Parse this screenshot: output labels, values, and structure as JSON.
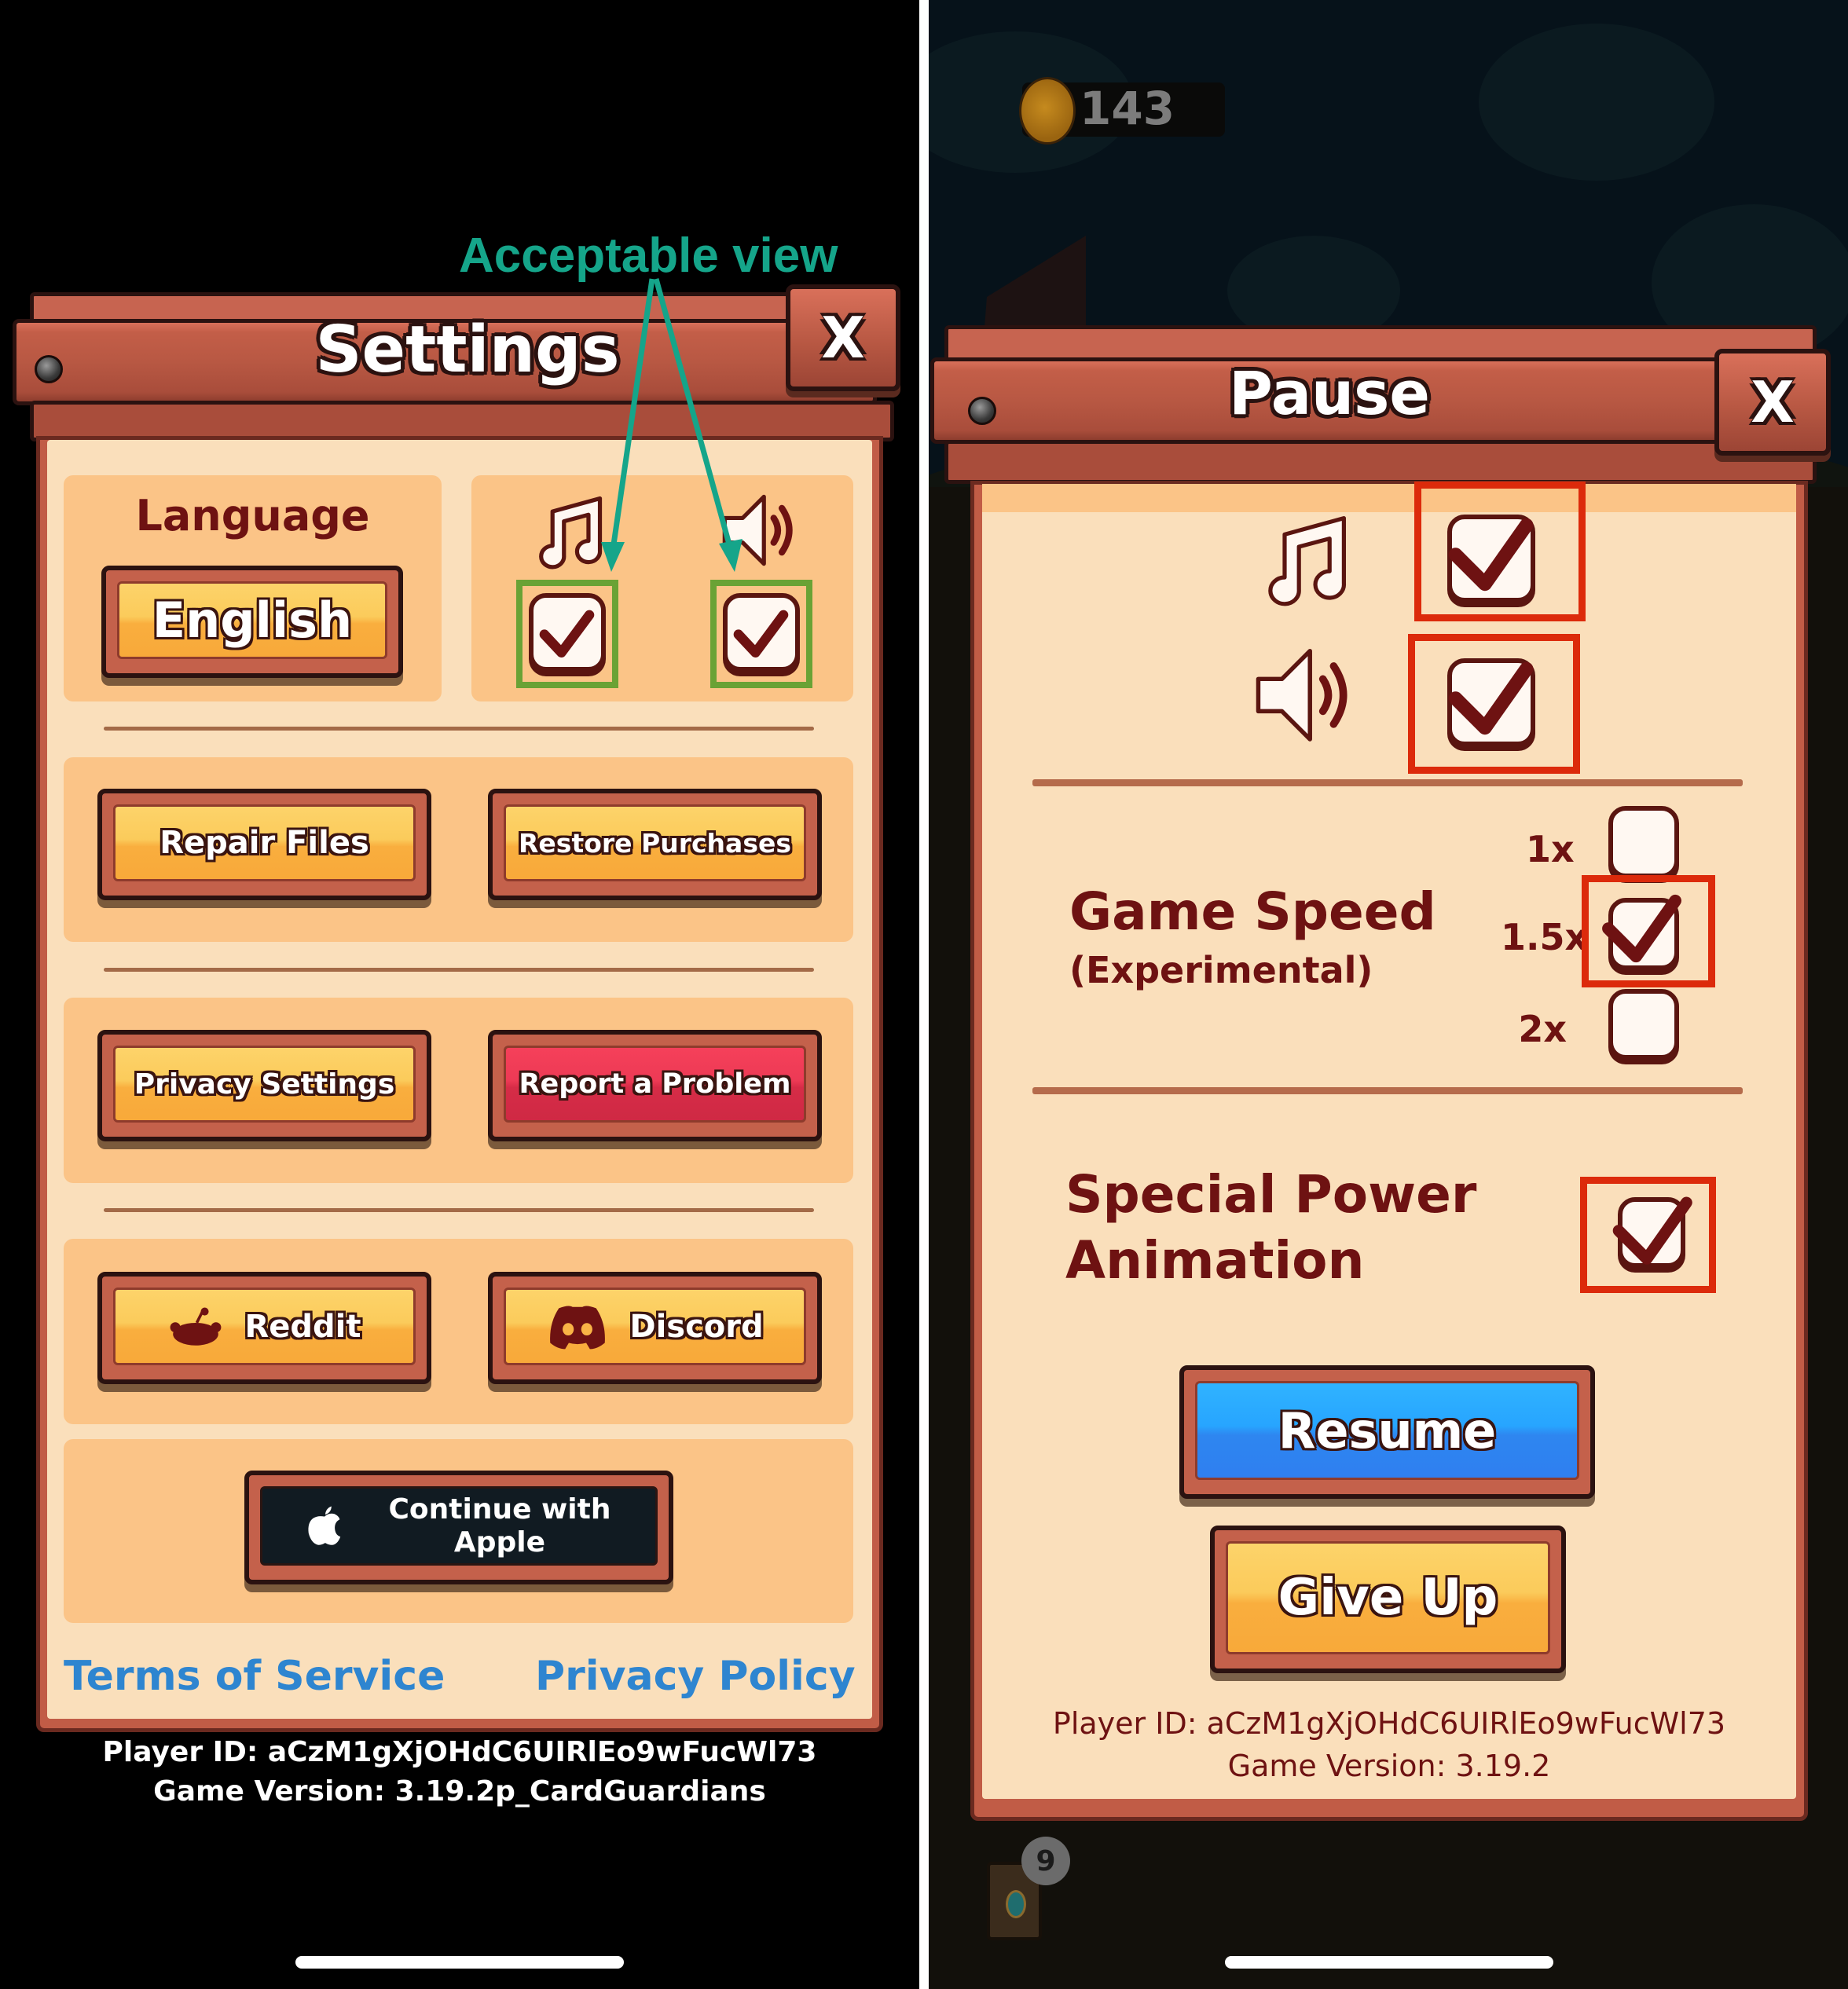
{
  "annotation": {
    "label": "Acceptable view",
    "color": "#15a58a"
  },
  "settings_screen": {
    "title": "Settings",
    "close_label": "X",
    "language": {
      "heading": "Language",
      "button_label": "English"
    },
    "audio": {
      "music_icon": "music-note-icon",
      "sound_icon": "speaker-icon",
      "music_enabled": true,
      "sound_enabled": true
    },
    "buttons": {
      "repair_files": "Repair Files",
      "restore_purchases": "Restore Purchases",
      "privacy_settings": "Privacy Settings",
      "report_problem": "Report a Problem",
      "reddit": "Reddit",
      "discord": "Discord",
      "continue_apple_line1": "Continue with",
      "continue_apple_line2": "Apple"
    },
    "links": {
      "terms": "Terms of Service",
      "privacy": "Privacy Policy"
    },
    "player_id": "Player ID: aCzM1gXjOHdC6UIRlEo9wFucWl73",
    "game_version": "Game Version: 3.19.2p_CardGuardians",
    "highlight_color": "#6aa235"
  },
  "pause_screen": {
    "coins": "143",
    "title": "Pause",
    "close_label": "X",
    "music_enabled": true,
    "sound_enabled": true,
    "game_speed": {
      "heading": "Game Speed",
      "subheading": "(Experimental)",
      "options": [
        {
          "label": "1x",
          "checked": false
        },
        {
          "label": "1.5x",
          "checked": true
        },
        {
          "label": "2x",
          "checked": false
        }
      ]
    },
    "special_power": {
      "line1": "Special Power",
      "line2": "Animation",
      "checked": true
    },
    "resume_label": "Resume",
    "give_up_label": "Give Up",
    "player_id": "Player ID: aCzM1gXjOHdC6UIRlEo9wFucWl73",
    "game_version": "Game Version: 3.19.2",
    "deck_count": "9",
    "highlight_color": "#dc2a0b"
  }
}
